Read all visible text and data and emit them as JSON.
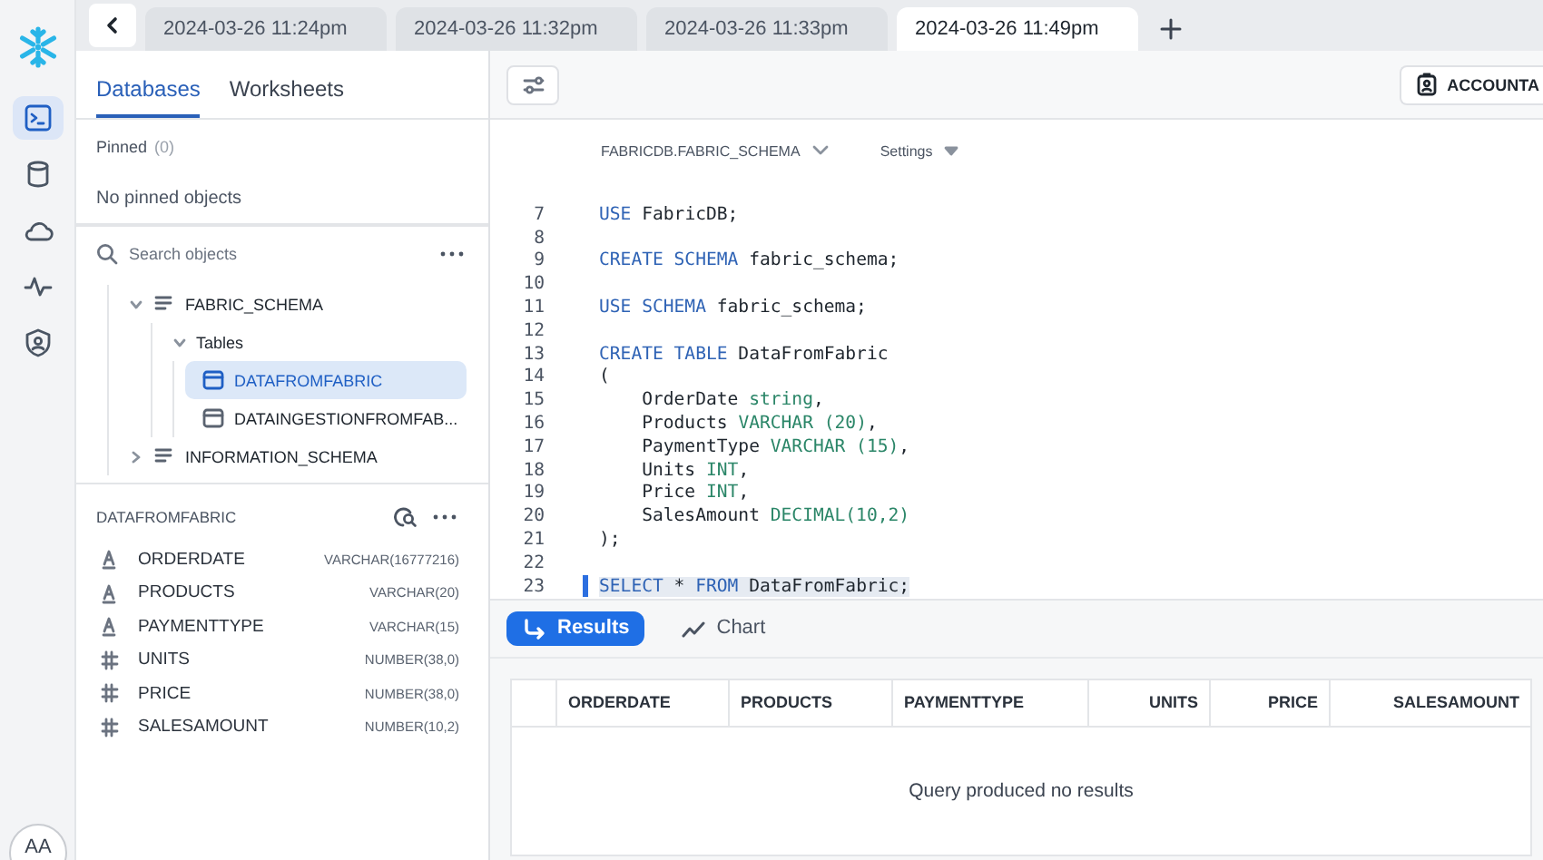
{
  "rail": {
    "items": [
      {
        "kind": "worksheet",
        "selected": true
      },
      {
        "kind": "data",
        "selected": false
      },
      {
        "kind": "cloud",
        "selected": false
      },
      {
        "kind": "activity",
        "selected": false
      },
      {
        "kind": "admin",
        "selected": false
      }
    ],
    "avatar": "AA"
  },
  "tabs": [
    {
      "label": "2024-03-26 11:24pm",
      "selected": false
    },
    {
      "label": "2024-03-26 11:32pm",
      "selected": false
    },
    {
      "label": "2024-03-26 11:33pm",
      "selected": false
    },
    {
      "label": "2024-03-26 11:49pm",
      "selected": true
    }
  ],
  "sidebar": {
    "tabs": [
      {
        "label": "Databases",
        "selected": true
      },
      {
        "label": "Worksheets",
        "selected": false
      }
    ],
    "pinned": {
      "label": "Pinned",
      "count": "(0)",
      "empty": "No pinned objects"
    },
    "search": {
      "placeholder": "Search objects"
    },
    "tree": [
      {
        "label": "FABRIC_SCHEMA",
        "kind": "schema",
        "expanded": true,
        "selected": false,
        "children": [
          {
            "label": "Tables",
            "kind": "folder",
            "expanded": true,
            "selected": false,
            "children": [
              {
                "label": "DATAFROMFABRIC",
                "kind": "table",
                "selected": true
              },
              {
                "label": "DATAINGESTIONFROMFAB...",
                "kind": "table",
                "selected": false
              }
            ]
          }
        ]
      },
      {
        "label": "INFORMATION_SCHEMA",
        "kind": "schema",
        "expanded": false,
        "selected": false
      }
    ],
    "details": {
      "title": "DATAFROMFABRIC",
      "columns": [
        {
          "name": "ORDERDATE",
          "type": "VARCHAR(16777216)",
          "kind": "text"
        },
        {
          "name": "PRODUCTS",
          "type": "VARCHAR(20)",
          "kind": "text"
        },
        {
          "name": "PAYMENTTYPE",
          "type": "VARCHAR(15)",
          "kind": "text"
        },
        {
          "name": "UNITS",
          "type": "NUMBER(38,0)",
          "kind": "number"
        },
        {
          "name": "PRICE",
          "type": "NUMBER(38,0)",
          "kind": "number"
        },
        {
          "name": "SALESAMOUNT",
          "type": "NUMBER(10,2)",
          "kind": "number"
        }
      ]
    }
  },
  "editor": {
    "account": "ACCOUNTA",
    "context": "FABRICDB.FABRIC_SCHEMA",
    "settings": "Settings",
    "lines": [
      {
        "number": "7",
        "current": false,
        "tokens": [
          {
            "text": "USE",
            "kind": "kw"
          },
          {
            "text": " FabricDB;",
            "kind": "plain"
          }
        ]
      },
      {
        "number": "8",
        "current": false
      },
      {
        "number": "9",
        "current": false,
        "tokens": [
          {
            "text": "CREATE SCHEMA",
            "kind": "kw"
          },
          {
            "text": " fabric_schema;",
            "kind": "plain"
          }
        ]
      },
      {
        "number": "10",
        "current": false
      },
      {
        "number": "11",
        "current": false,
        "tokens": [
          {
            "text": "USE SCHEMA",
            "kind": "kw"
          },
          {
            "text": " fabric_schema;",
            "kind": "plain"
          }
        ]
      },
      {
        "number": "12",
        "current": false
      },
      {
        "number": "13",
        "current": false,
        "tokens": [
          {
            "text": "CREATE TABLE",
            "kind": "kw"
          },
          {
            "text": " DataFromFabric",
            "kind": "plain"
          }
        ]
      },
      {
        "number": "14",
        "current": false,
        "tokens": [
          {
            "text": "(",
            "kind": "plain"
          }
        ]
      },
      {
        "number": "15",
        "current": false,
        "tokens": [
          {
            "text": "    OrderDate ",
            "kind": "plain"
          },
          {
            "text": "string",
            "kind": "type"
          },
          {
            "text": ",",
            "kind": "plain"
          }
        ]
      },
      {
        "number": "16",
        "current": false,
        "tokens": [
          {
            "text": "    Products ",
            "kind": "plain"
          },
          {
            "text": "VARCHAR (20)",
            "kind": "type"
          },
          {
            "text": ",",
            "kind": "plain"
          }
        ]
      },
      {
        "number": "17",
        "current": false,
        "tokens": [
          {
            "text": "    PaymentType ",
            "kind": "plain"
          },
          {
            "text": "VARCHAR (15)",
            "kind": "type"
          },
          {
            "text": ",",
            "kind": "plain"
          }
        ]
      },
      {
        "number": "18",
        "current": false,
        "tokens": [
          {
            "text": "    Units ",
            "kind": "plain"
          },
          {
            "text": "INT",
            "kind": "type"
          },
          {
            "text": ",",
            "kind": "plain"
          }
        ]
      },
      {
        "number": "19",
        "current": false,
        "tokens": [
          {
            "text": "    Price ",
            "kind": "plain"
          },
          {
            "text": "INT",
            "kind": "type"
          },
          {
            "text": ",",
            "kind": "plain"
          }
        ]
      },
      {
        "number": "20",
        "current": false,
        "tokens": [
          {
            "text": "    SalesAmount ",
            "kind": "plain"
          },
          {
            "text": "DECIMAL(10,2)",
            "kind": "type"
          }
        ]
      },
      {
        "number": "21",
        "current": false,
        "tokens": [
          {
            "text": ");",
            "kind": "plain"
          }
        ]
      },
      {
        "number": "22",
        "current": false
      },
      {
        "number": "23",
        "current": true,
        "tokens": [
          {
            "text": "SELECT",
            "kind": "kw"
          },
          {
            "text": " * ",
            "kind": "plain"
          },
          {
            "text": "FROM",
            "kind": "kw"
          },
          {
            "text": " DataFromFabric;",
            "kind": "plain"
          }
        ]
      }
    ]
  },
  "results": {
    "tabs": [
      {
        "label": "Results",
        "kind": "results",
        "selected": true
      },
      {
        "label": "Chart",
        "kind": "chart",
        "selected": false
      }
    ],
    "columns": [
      {
        "label": "ORDERDATE",
        "kind": "text"
      },
      {
        "label": "PRODUCTS",
        "kind": "text"
      },
      {
        "label": "PAYMENTTYPE",
        "kind": "text"
      },
      {
        "label": "UNITS",
        "kind": "number"
      },
      {
        "label": "PRICE",
        "kind": "number"
      },
      {
        "label": "SALESAMOUNT",
        "kind": "number"
      }
    ],
    "empty": "Query produced no results"
  }
}
